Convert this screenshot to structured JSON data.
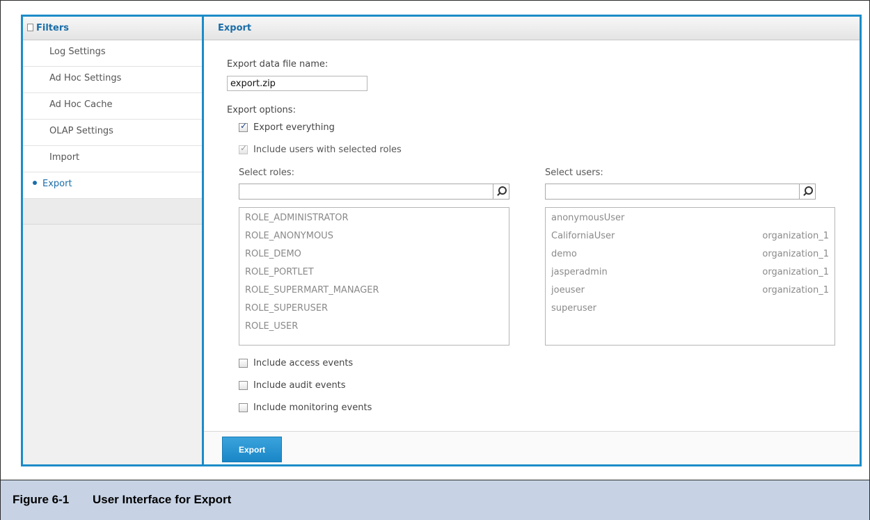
{
  "sidebar": {
    "title": "Filters",
    "items": [
      {
        "label": "Log Settings"
      },
      {
        "label": "Ad Hoc Settings"
      },
      {
        "label": "Ad Hoc Cache"
      },
      {
        "label": "OLAP Settings"
      },
      {
        "label": "Import"
      },
      {
        "label": "Export",
        "active": true
      }
    ]
  },
  "main": {
    "title": "Export",
    "file_name_label": "Export data file name:",
    "file_name_value": "export.zip",
    "options_label": "Export options:",
    "export_everything": {
      "label": "Export everything",
      "checked": true
    },
    "include_users": {
      "label": "Include users with selected roles",
      "checked": true,
      "disabled": true
    },
    "roles": {
      "label": "Select roles:",
      "search_value": "",
      "items": [
        "ROLE_ADMINISTRATOR",
        "ROLE_ANONYMOUS",
        "ROLE_DEMO",
        "ROLE_PORTLET",
        "ROLE_SUPERMART_MANAGER",
        "ROLE_SUPERUSER",
        "ROLE_USER"
      ]
    },
    "users": {
      "label": "Select users:",
      "search_value": "",
      "items": [
        {
          "name": "anonymousUser",
          "org": ""
        },
        {
          "name": "CaliforniaUser",
          "org": "organization_1"
        },
        {
          "name": "demo",
          "org": "organization_1"
        },
        {
          "name": "jasperadmin",
          "org": "organization_1"
        },
        {
          "name": "joeuser",
          "org": "organization_1"
        },
        {
          "name": "superuser",
          "org": ""
        }
      ]
    },
    "access_events": {
      "label": "Include access events",
      "checked": false
    },
    "audit_events": {
      "label": "Include audit events",
      "checked": false
    },
    "monitoring_events": {
      "label": "Include monitoring events",
      "checked": false
    },
    "export_button": "Export"
  },
  "caption": {
    "number": "Figure 6-1",
    "title": "User Interface for Export"
  },
  "colors": {
    "accent": "#1c8cc8",
    "caption_bg": "#c7d3e5"
  }
}
